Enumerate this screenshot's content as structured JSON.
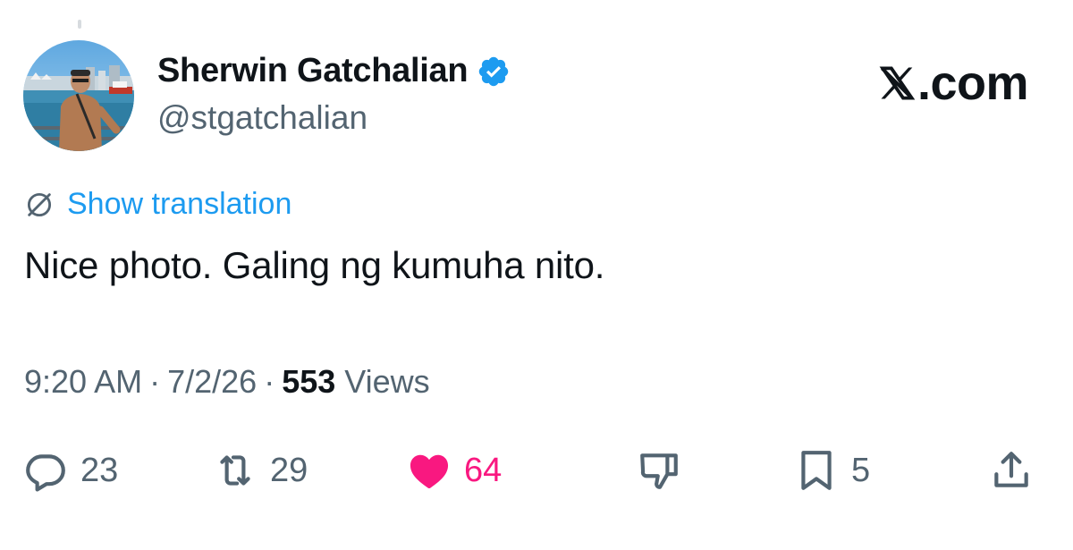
{
  "author": {
    "display_name": "Sherwin Gatchalian",
    "handle": "@stgatchalian",
    "verified": true,
    "verified_color": "#1d9bf0"
  },
  "brand": {
    "label": ".com",
    "logo_icon": "x-logo-icon"
  },
  "translation": {
    "label": "Show translation",
    "icon": "globe-icon"
  },
  "tweet": {
    "text": "Nice photo. Galing ng kumuha nito."
  },
  "meta": {
    "time": "9:20 AM",
    "date": "7/2/26",
    "separator": "·",
    "views_count": "553",
    "views_label": "Views"
  },
  "actions": {
    "reply": {
      "icon": "reply-icon",
      "count": "23"
    },
    "repost": {
      "icon": "repost-icon",
      "count": "29"
    },
    "like": {
      "icon": "heart-icon",
      "count": "64",
      "liked": true,
      "color": "#f91880"
    },
    "dislike": {
      "icon": "thumbs-down-icon"
    },
    "bookmark": {
      "icon": "bookmark-icon",
      "count": "5"
    },
    "share": {
      "icon": "share-icon"
    }
  }
}
